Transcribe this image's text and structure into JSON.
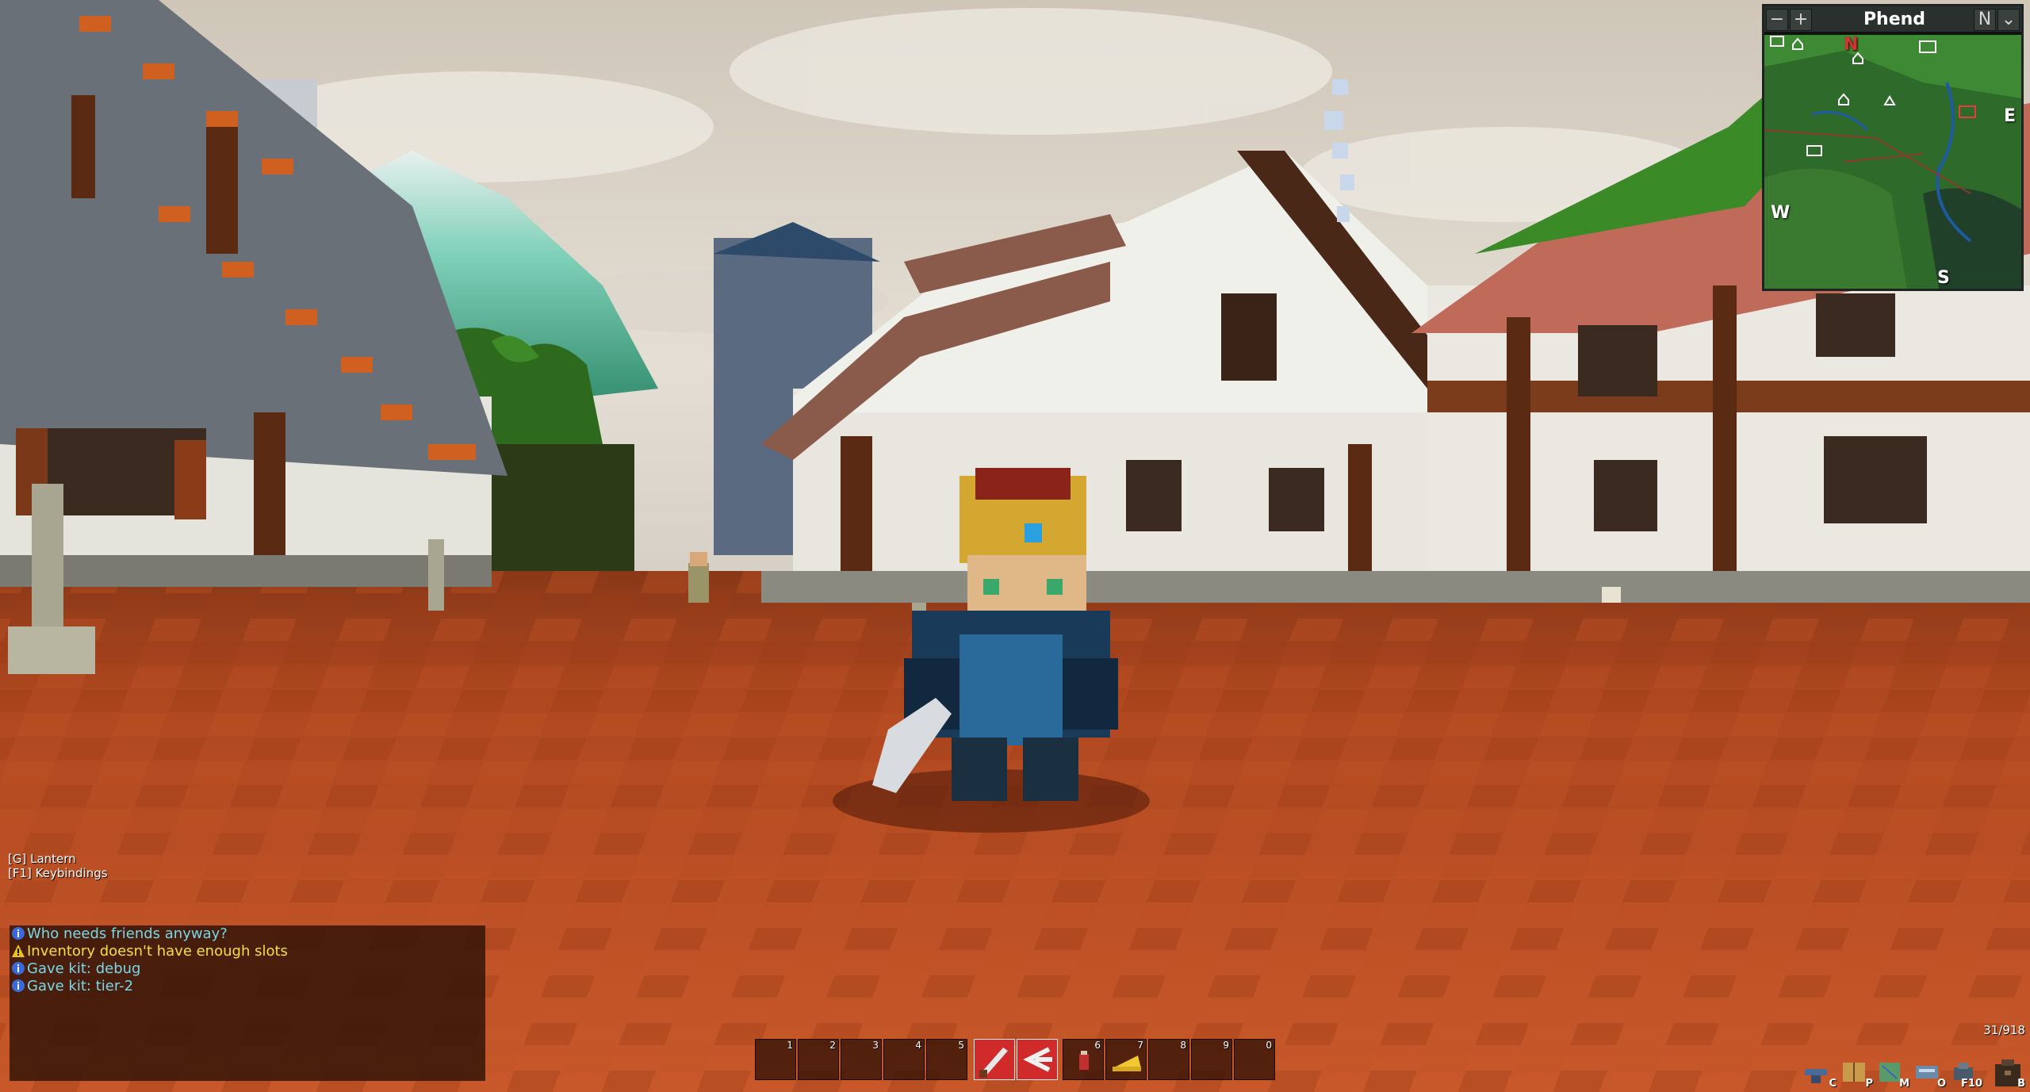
{
  "minimap": {
    "location_name": "Phend",
    "zoom_out_label": "−",
    "zoom_in_label": "+",
    "north_lock_label": "N",
    "collapse_label": "⌄",
    "compass": {
      "n": "N",
      "e": "E",
      "s": "S",
      "w": "W"
    }
  },
  "hints": {
    "lantern": "[G] Lantern",
    "keybindings": "[F1] Keybindings"
  },
  "chat": {
    "messages": [
      {
        "icon": "info-icon",
        "text": "Who needs friends anyway?",
        "color": "#78d8e8"
      },
      {
        "icon": "warning-icon",
        "text": "Inventory doesn't have enough slots",
        "color": "#f0e040"
      },
      {
        "icon": "info-icon",
        "text": "Gave kit: debug",
        "color": "#78d8e8"
      },
      {
        "icon": "info-icon",
        "text": "Gave kit: tier-2",
        "color": "#78d8e8"
      }
    ]
  },
  "hotbar": {
    "slots": [
      {
        "key": "1",
        "item": ""
      },
      {
        "key": "2",
        "item": ""
      },
      {
        "key": "3",
        "item": ""
      },
      {
        "key": "4",
        "item": ""
      },
      {
        "key": "5",
        "item": ""
      },
      {
        "key": "",
        "item": "sword-icon"
      },
      {
        "key": "",
        "item": "ability-icon"
      },
      {
        "key": "6",
        "item": "potion-icon"
      },
      {
        "key": "7",
        "item": "cheese-icon"
      },
      {
        "key": "8",
        "item": ""
      },
      {
        "key": "9",
        "item": ""
      },
      {
        "key": "0",
        "item": ""
      }
    ]
  },
  "counter": "31/918",
  "menu_buttons": [
    {
      "icon": "crafting-icon",
      "key": "C"
    },
    {
      "icon": "spellbook-icon",
      "key": "P"
    },
    {
      "icon": "map-icon",
      "key": "M"
    },
    {
      "icon": "social-icon",
      "key": "O"
    },
    {
      "icon": "settings-icon",
      "key": "F10"
    },
    {
      "icon": "bag-icon",
      "key": "B"
    }
  ],
  "colors": {
    "ground": "#b84a1e",
    "sky": "#d8d2c8",
    "roof_red": "#b85a4a",
    "wood": "#6a3418",
    "plaster": "#e6e6dc"
  }
}
